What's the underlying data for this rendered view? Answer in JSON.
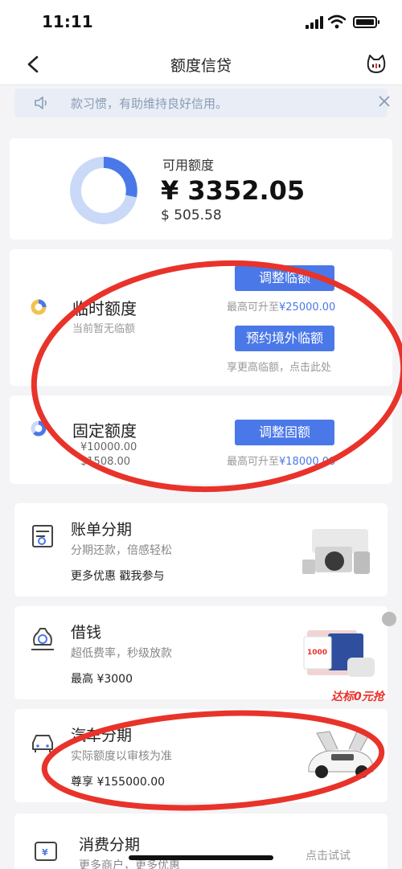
{
  "status_bar": {
    "time": "11:11"
  },
  "nav": {
    "title": "额度信贷"
  },
  "notice": {
    "text": "款习惯，有助维持良好信用。"
  },
  "available": {
    "label": "可用额度",
    "amount": "¥ 3352.05",
    "usd": "$ 505.58"
  },
  "temporary": {
    "title": "临时额度",
    "subtitle": "当前暂无临额",
    "adjust_button": "调整临额",
    "adjust_hint_prefix": "最高可升至",
    "adjust_hint_value": "¥25000.00",
    "overseas_button": "预约境外临额",
    "overseas_hint": "享更高临额，点击此处"
  },
  "fixed": {
    "title": "固定额度",
    "cny": "¥10000.00",
    "usd": "$1508.00",
    "adjust_button": "调整固额",
    "hint_prefix": "最高可升至",
    "hint_value": "¥18000.00"
  },
  "products": [
    {
      "name": "账单分期",
      "desc": "分期还款，倍感轻松",
      "promo": "更多优惠 戳我参与"
    },
    {
      "name": "借钱",
      "desc": "超低费率，秒级放款",
      "promo": "最高 ¥3000"
    },
    {
      "name": "汽车分期",
      "desc": "实际额度以审核为准",
      "promo": "尊享 ¥155000.00"
    },
    {
      "name": "消费分期",
      "desc": "更多商户，更多优惠",
      "promo": ""
    }
  ],
  "loan_art": {
    "tag": "达标0元抢",
    "badge_text": "1000"
  },
  "consumer_cta": "点击试试",
  "colors": {
    "accent": "#4a78e8",
    "annotation_red": "#e8332a",
    "donut_light": "#c9d9f7"
  }
}
